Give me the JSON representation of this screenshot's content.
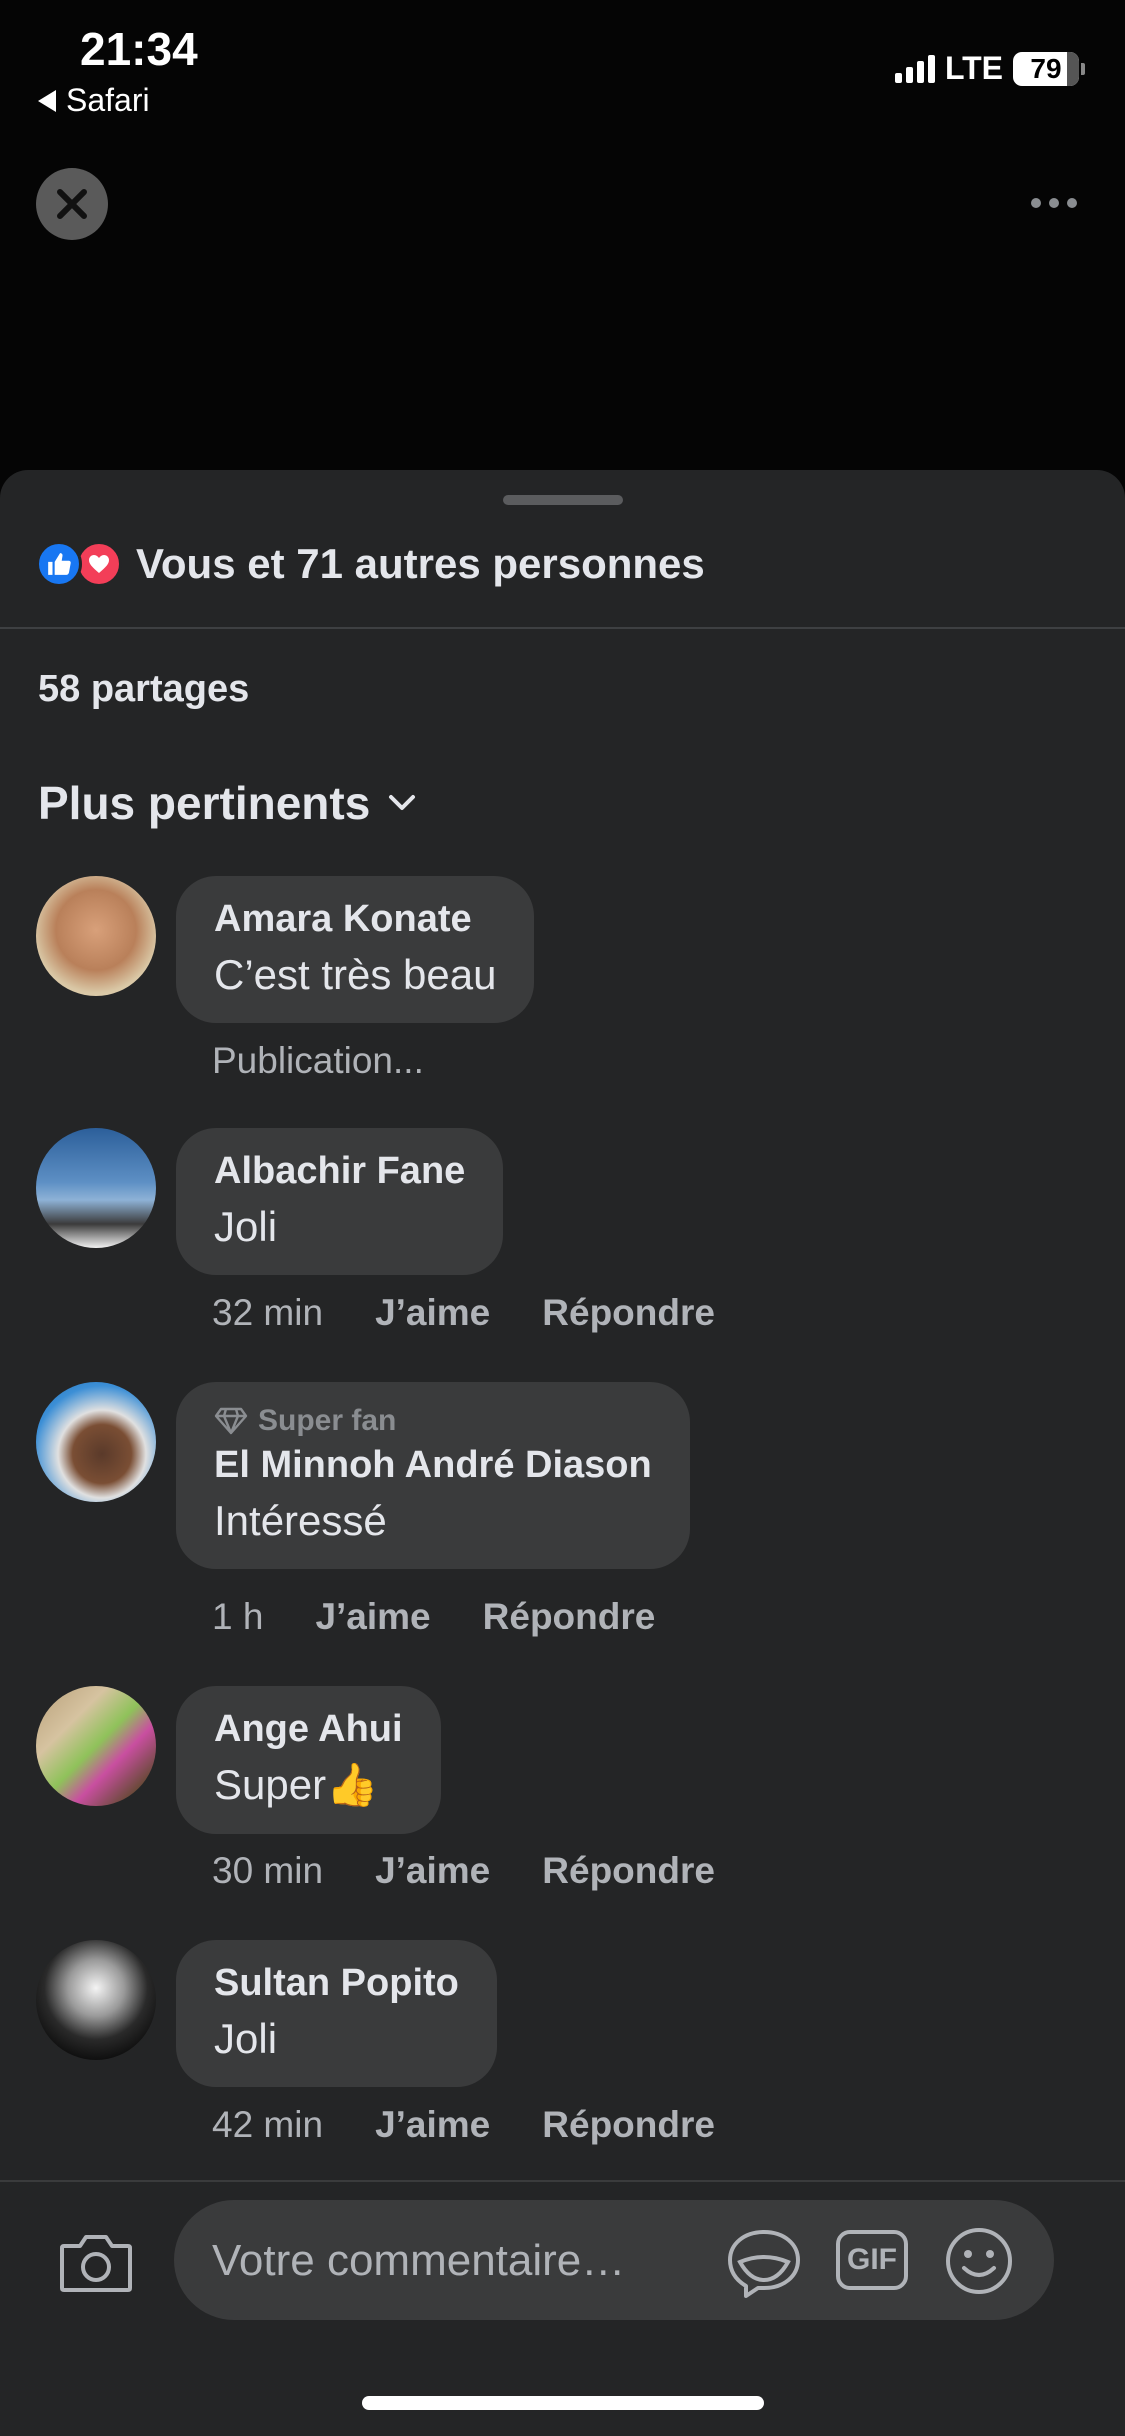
{
  "status": {
    "time": "21:34",
    "back_app": "Safari",
    "network": "LTE",
    "battery": "79",
    "battery_level": 0.79
  },
  "sheet": {
    "reactions_text": "Vous et 71 autres personnes",
    "reaction_icons": [
      "like-icon",
      "love-icon"
    ],
    "shares": "58 partages",
    "sort_label": "Plus pertinents"
  },
  "comments": [
    {
      "author": "Amara Konate",
      "text": "C’est très beau",
      "status": "Publication..."
    },
    {
      "author": "Albachir Fane",
      "text": "Joli",
      "time": "32 min",
      "like": "J’aime",
      "reply": "Répondre"
    },
    {
      "badge": "Super fan",
      "author": "El Minnoh André Diason",
      "text": "Intéressé",
      "time": "1 h",
      "like": "J’aime",
      "reply": "Répondre"
    },
    {
      "author": "Ange Ahui",
      "text": "Super👍",
      "time": "30 min",
      "like": "J’aime",
      "reply": "Répondre"
    },
    {
      "author": "Sultan Popito",
      "text": "Joli",
      "time": "42 min",
      "like": "J’aime",
      "reply": "Répondre"
    }
  ],
  "composer": {
    "placeholder": "Votre commentaire…",
    "gif_label": "GIF"
  },
  "colors": {
    "like": "#1877f2",
    "love": "#f33e58",
    "bubble": "#3a3b3c",
    "sheet": "#242526"
  }
}
